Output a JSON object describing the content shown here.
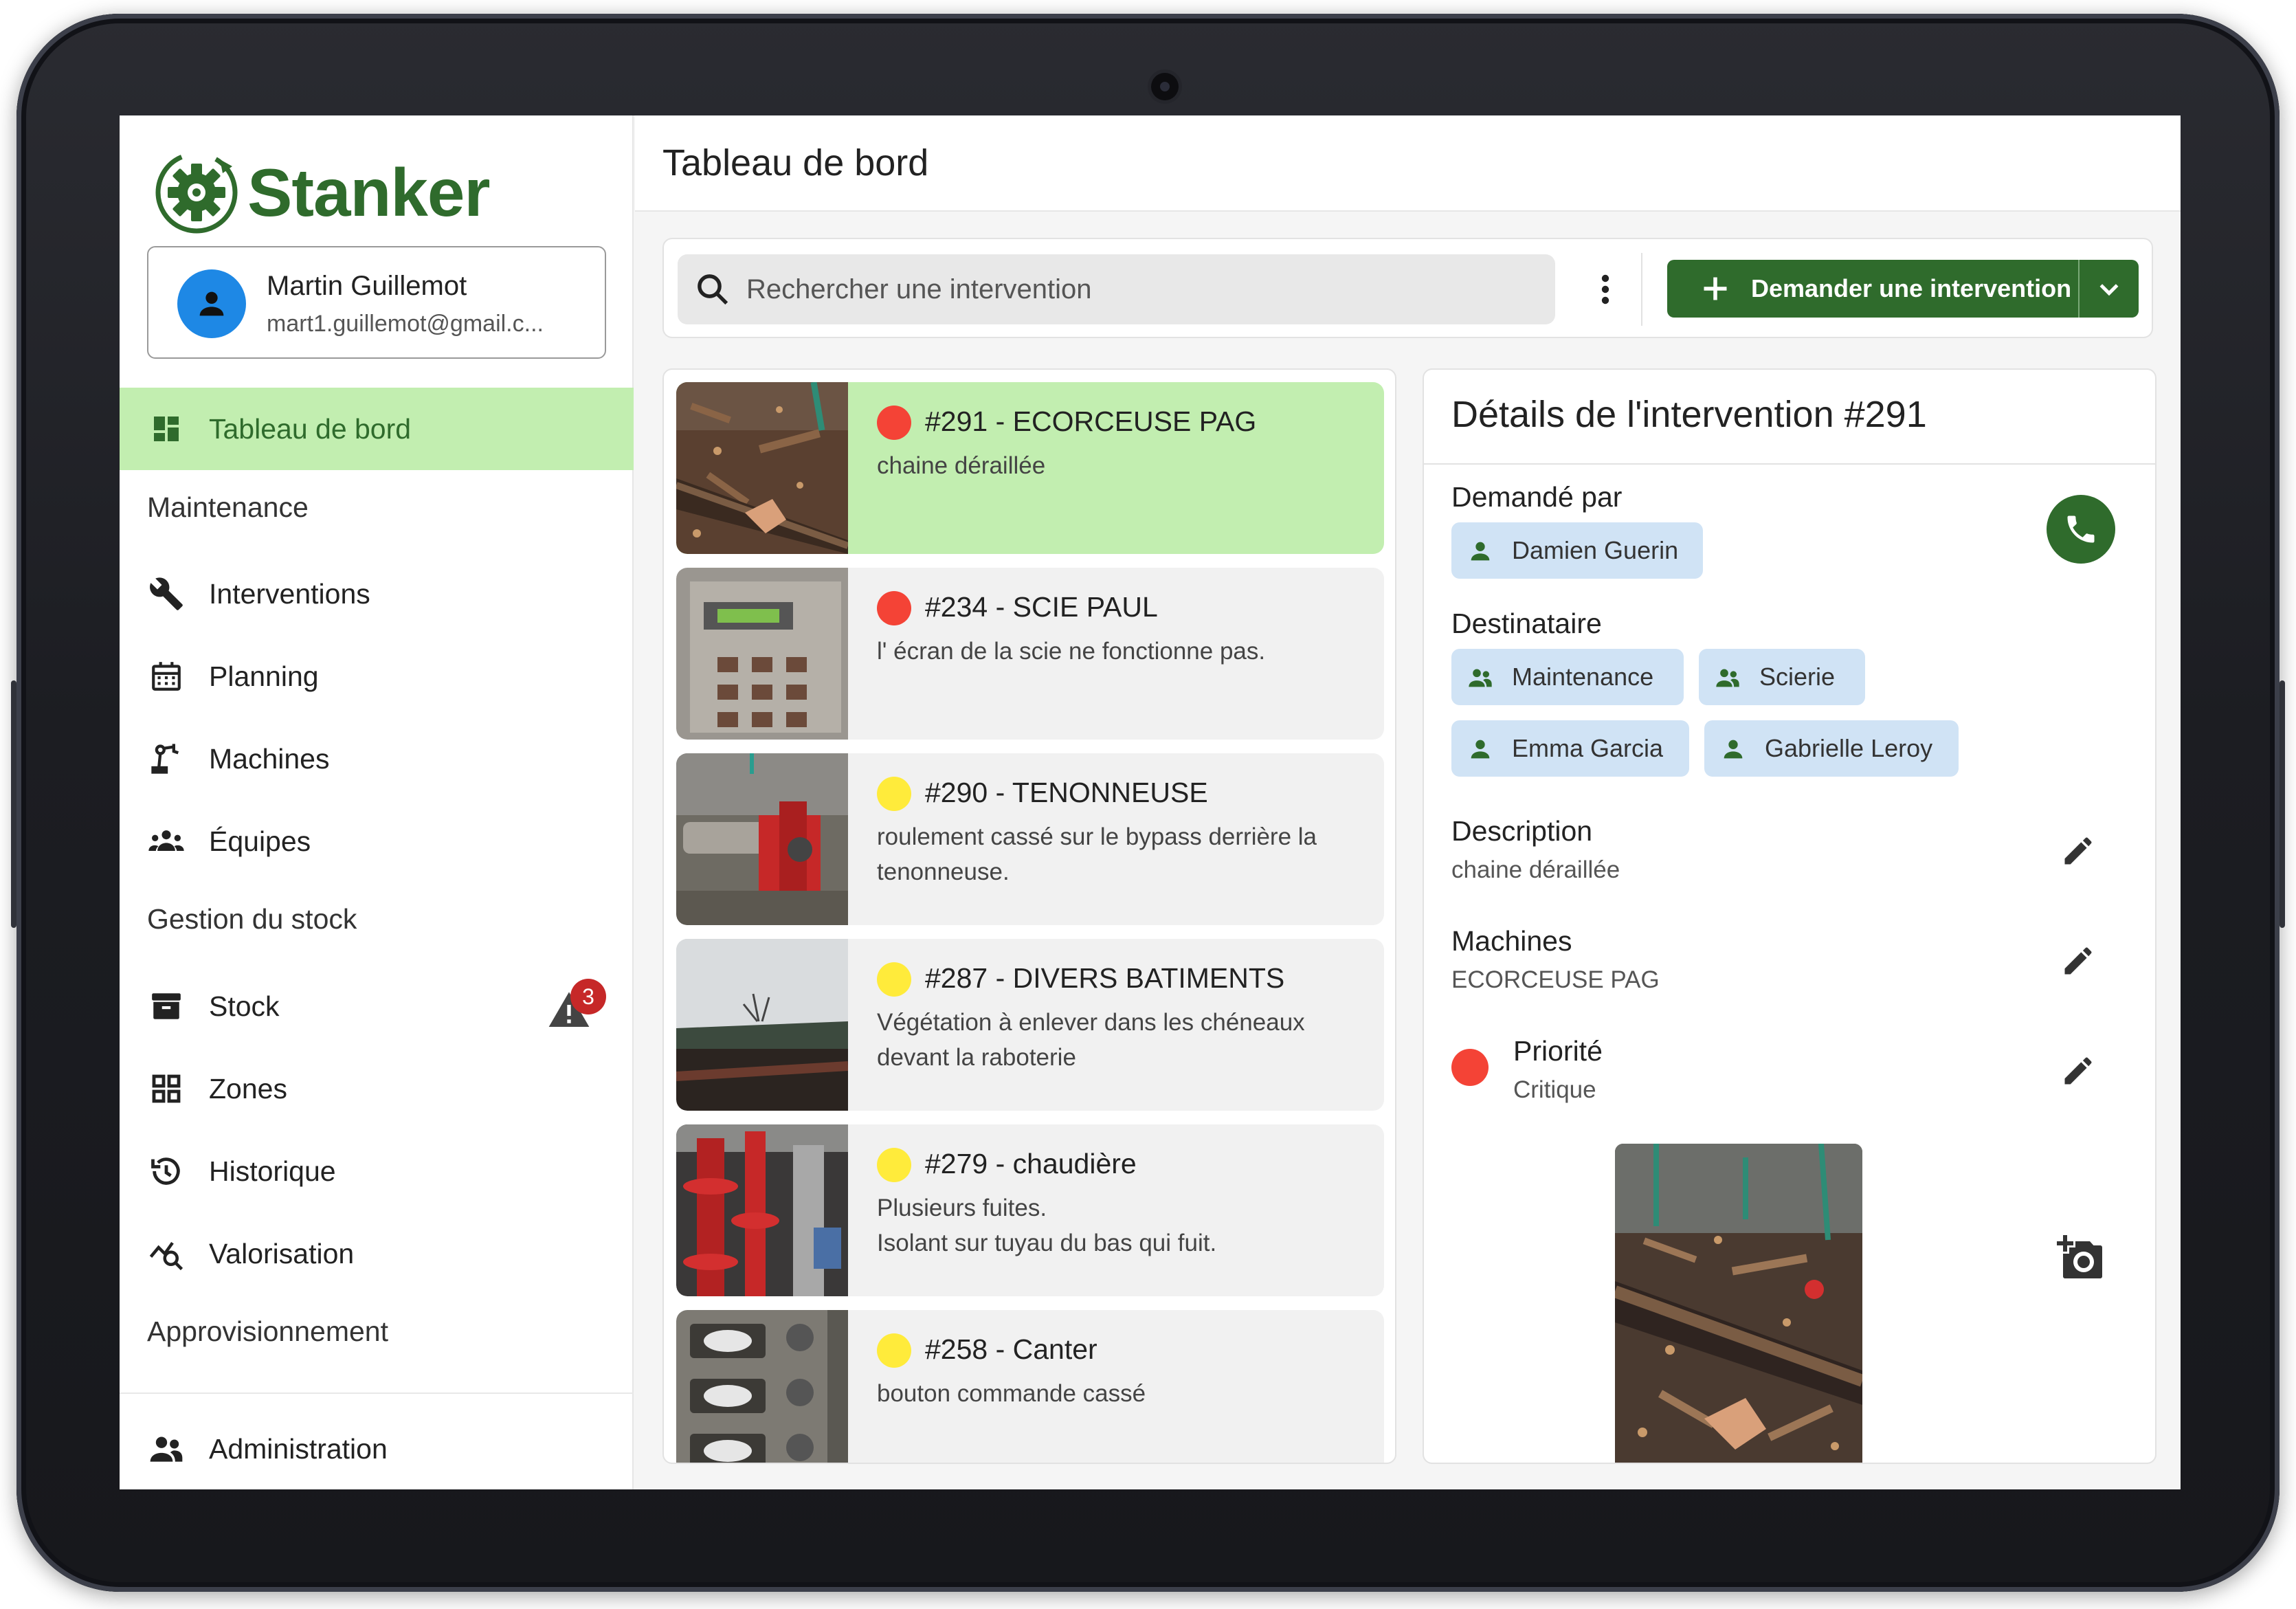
{
  "app": {
    "name": "Stanker",
    "brand_color": "#2f6b2c",
    "accent_light": "#c2eeb0"
  },
  "user": {
    "name": "Martin Guillemot",
    "email": "mart1.guillemot@gmail.c..."
  },
  "sidebar": {
    "items": [
      {
        "label": "Tableau de bord",
        "icon": "dashboard-icon",
        "active": true
      },
      {
        "section": "Maintenance"
      },
      {
        "label": "Interventions",
        "icon": "wrench-icon"
      },
      {
        "label": "Planning",
        "icon": "calendar-icon"
      },
      {
        "label": "Machines",
        "icon": "precision-manufacturing-icon"
      },
      {
        "label": "Équipes",
        "icon": "groups-icon"
      },
      {
        "section": "Gestion du stock"
      },
      {
        "label": "Stock",
        "icon": "inventory-icon",
        "badge": "3"
      },
      {
        "label": "Zones",
        "icon": "grid-icon"
      },
      {
        "label": "Historique",
        "icon": "history-icon"
      },
      {
        "label": "Valorisation",
        "icon": "query-stats-icon"
      },
      {
        "section": "Approvisionnement"
      },
      {
        "label": "Administration",
        "icon": "people-icon"
      }
    ]
  },
  "header": {
    "title": "Tableau de bord"
  },
  "toolbar": {
    "search_placeholder": "Rechercher une intervention",
    "cta_label": "Demander une intervention"
  },
  "interventions": [
    {
      "title": "#291 - ECORCEUSE PAG",
      "desc": "chaine déraillée",
      "priority_color": "#f44336",
      "selected": true
    },
    {
      "title": "#234 - SCIE PAUL",
      "desc": "l' écran de la scie ne fonctionne pas.",
      "priority_color": "#f44336"
    },
    {
      "title": "#290 - TENONNEUSE",
      "desc": "roulement cassé sur le bypass derrière la tenonneuse.",
      "priority_color": "#ffeb3b"
    },
    {
      "title": "#287 - DIVERS BATIMENTS",
      "desc": "Végétation à enlever dans les chéneaux devant la raboterie",
      "priority_color": "#ffeb3b"
    },
    {
      "title": "#279 - chaudière",
      "desc": "Plusieurs fuites.\nIsolant sur tuyau du bas qui fuit.",
      "priority_color": "#ffeb3b"
    },
    {
      "title": "#258 - Canter",
      "desc": "bouton commande cassé",
      "priority_color": "#ffeb3b"
    }
  ],
  "details": {
    "title": "Détails de l'intervention #291",
    "requested_by_label": "Demandé par",
    "requested_by": "Damien Guerin",
    "recipient_label": "Destinataire",
    "recipients": [
      "Maintenance",
      "Scierie",
      "Emma Garcia",
      "Gabrielle Leroy"
    ],
    "description_label": "Description",
    "description": "chaine déraillée",
    "machines_label": "Machines",
    "machines": "ECORCEUSE PAG",
    "priority_label": "Priorité",
    "priority": "Critique",
    "priority_color": "#f44336"
  }
}
